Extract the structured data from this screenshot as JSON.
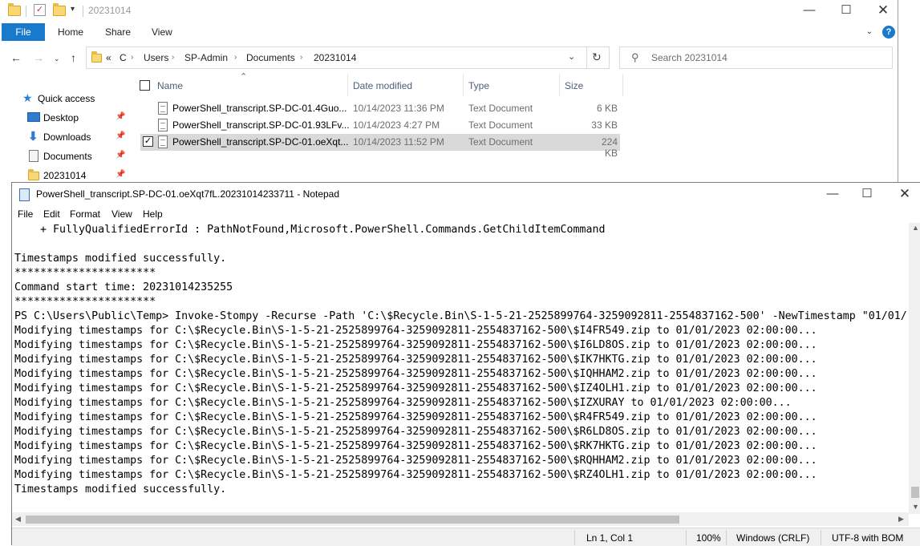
{
  "explorer": {
    "title": "20231014",
    "ribbon_tabs": {
      "file": "File",
      "home": "Home",
      "share": "Share",
      "view": "View"
    },
    "address": {
      "overflow": "«",
      "crumbs": [
        "C",
        "Users",
        "SP-Admin",
        "Documents",
        "20231014"
      ]
    },
    "search_placeholder": "Search 20231014",
    "sidebar": {
      "quick_access": "Quick access",
      "items": [
        "Desktop",
        "Downloads",
        "Documents",
        "20231014"
      ]
    },
    "columns": {
      "name": "Name",
      "date": "Date modified",
      "type": "Type",
      "size": "Size"
    },
    "files": [
      {
        "name": "PowerShell_transcript.SP-DC-01.4Guo...",
        "date": "10/14/2023 11:36 PM",
        "type": "Text Document",
        "size": "6 KB"
      },
      {
        "name": "PowerShell_transcript.SP-DC-01.93LFv...",
        "date": "10/14/2023 4:27 PM",
        "type": "Text Document",
        "size": "33 KB"
      },
      {
        "name": "PowerShell_transcript.SP-DC-01.oeXqt...",
        "date": "10/14/2023 11:52 PM",
        "type": "Text Document",
        "size": "224 KB"
      }
    ]
  },
  "notepad": {
    "title": "PowerShell_transcript.SP-DC-01.oeXqt7fL.20231014233711 - Notepad",
    "menu": [
      "File",
      "Edit",
      "Format",
      "View",
      "Help"
    ],
    "content": "    + FullyQualifiedErrorId : PathNotFound,Microsoft.PowerShell.Commands.GetChildItemCommand\n\nTimestamps modified successfully.\n**********************\nCommand start time: 20231014235255\n**********************\nPS C:\\Users\\Public\\Temp> Invoke-Stompy -Recurse -Path 'C:\\$Recycle.Bin\\S-1-5-21-2525899764-3259092811-2554837162-500' -NewTimestamp \"01/01/\nModifying timestamps for C:\\$Recycle.Bin\\S-1-5-21-2525899764-3259092811-2554837162-500\\$I4FR549.zip to 01/01/2023 02:00:00...\nModifying timestamps for C:\\$Recycle.Bin\\S-1-5-21-2525899764-3259092811-2554837162-500\\$I6LD8OS.zip to 01/01/2023 02:00:00...\nModifying timestamps for C:\\$Recycle.Bin\\S-1-5-21-2525899764-3259092811-2554837162-500\\$IK7HKTG.zip to 01/01/2023 02:00:00...\nModifying timestamps for C:\\$Recycle.Bin\\S-1-5-21-2525899764-3259092811-2554837162-500\\$IQHHAM2.zip to 01/01/2023 02:00:00...\nModifying timestamps for C:\\$Recycle.Bin\\S-1-5-21-2525899764-3259092811-2554837162-500\\$IZ4OLH1.zip to 01/01/2023 02:00:00...\nModifying timestamps for C:\\$Recycle.Bin\\S-1-5-21-2525899764-3259092811-2554837162-500\\$IZXURAY to 01/01/2023 02:00:00...\nModifying timestamps for C:\\$Recycle.Bin\\S-1-5-21-2525899764-3259092811-2554837162-500\\$R4FR549.zip to 01/01/2023 02:00:00...\nModifying timestamps for C:\\$Recycle.Bin\\S-1-5-21-2525899764-3259092811-2554837162-500\\$R6LD8OS.zip to 01/01/2023 02:00:00...\nModifying timestamps for C:\\$Recycle.Bin\\S-1-5-21-2525899764-3259092811-2554837162-500\\$RK7HKTG.zip to 01/01/2023 02:00:00...\nModifying timestamps for C:\\$Recycle.Bin\\S-1-5-21-2525899764-3259092811-2554837162-500\\$RQHHAM2.zip to 01/01/2023 02:00:00...\nModifying timestamps for C:\\$Recycle.Bin\\S-1-5-21-2525899764-3259092811-2554837162-500\\$RZ4OLH1.zip to 01/01/2023 02:00:00...\nTimestamps modified successfully.",
    "status": {
      "position": "Ln 1, Col 1",
      "zoom": "100%",
      "line_ending": "Windows (CRLF)",
      "encoding": "UTF-8 with BOM"
    }
  }
}
